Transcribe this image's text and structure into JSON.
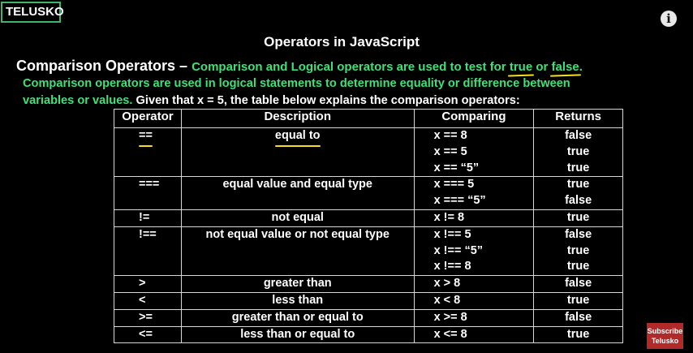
{
  "brand": {
    "logo": "TELUSKO",
    "info_icon": "info-icon"
  },
  "slide": {
    "title": "Operators in JavaScript",
    "heading": "Comparison Operators –",
    "intro_a": "Comparison and Logical operators are used to test for",
    "intro_true": "true",
    "intro_or": "or",
    "intro_false": "false",
    "intro_end": ".",
    "line2": "Comparison operators are used in logical statements to determine equality or difference between",
    "line3_green": "variables or values.",
    "line3_white": "Given that x = 5, the table below explains the comparison operators:"
  },
  "table": {
    "headers": [
      "Operator",
      "Description",
      "Comparing",
      "Returns"
    ],
    "rows": [
      {
        "op": "==",
        "desc": "equal to",
        "cmp": [
          "x == 8",
          "x == 5",
          "x == “5”"
        ],
        "ret": [
          "false",
          "true",
          "true"
        ]
      },
      {
        "op": "===",
        "desc": "equal value and equal type",
        "cmp": [
          "x === 5",
          "x === “5”"
        ],
        "ret": [
          "true",
          "false"
        ]
      },
      {
        "op": "!=",
        "desc": "not equal",
        "cmp": [
          "x != 8"
        ],
        "ret": [
          "true"
        ]
      },
      {
        "op": "!==",
        "desc": "not equal value or not equal type",
        "cmp": [
          "x !== 5",
          "x !== “5”",
          "x !== 8"
        ],
        "ret": [
          "false",
          "true",
          "true"
        ]
      },
      {
        "op": ">",
        "desc": "greater than",
        "cmp": [
          "x > 8"
        ],
        "ret": [
          "false"
        ]
      },
      {
        "op": "<",
        "desc": "less than",
        "cmp": [
          "x < 8"
        ],
        "ret": [
          "true"
        ]
      },
      {
        "op": ">=",
        "desc": "greater than or equal to",
        "cmp": [
          "x >= 8"
        ],
        "ret": [
          "false"
        ]
      },
      {
        "op": "<=",
        "desc": "less than or equal to",
        "cmp": [
          "x <= 8"
        ],
        "ret": [
          "true"
        ]
      }
    ]
  },
  "subscribe": {
    "line1": "Subscribe",
    "line2": "Telusko"
  },
  "colors": {
    "green": "#3ee07a",
    "underline": "#f4e11c",
    "logo_border": "#3db56c",
    "subscribe_bg": "#b02a2a"
  }
}
